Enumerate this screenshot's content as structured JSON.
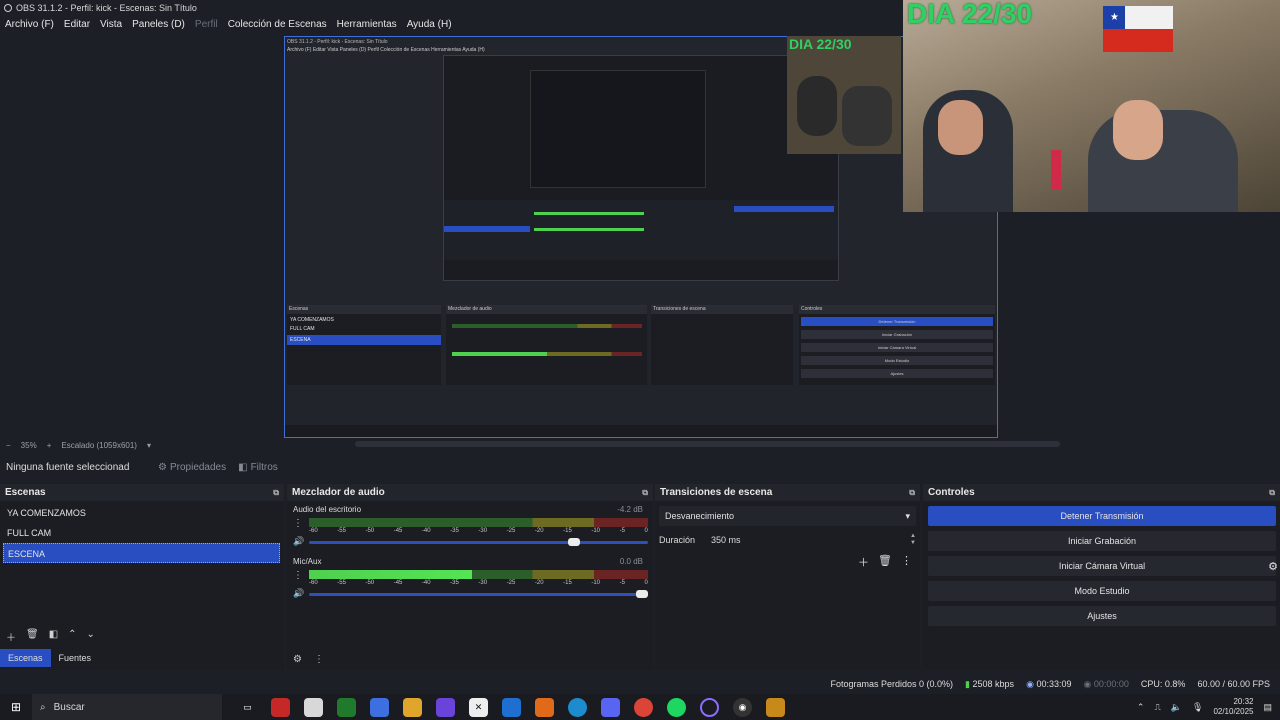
{
  "window": {
    "title": "OBS 31.1.2 - Perfil: kick - Escenas: Sin Título"
  },
  "menu": [
    "Archivo (F)",
    "Editar",
    "Vista",
    "Paneles (D)",
    "Perfil",
    "Colección de Escenas",
    "Herramientas",
    "Ayuda (H)"
  ],
  "overlay": {
    "day_counter": "DIA 22/30",
    "nested_counter": "DIA 22/30"
  },
  "nested": {
    "title": "OBS 31.1.2 - Perfil: kick - Escenas: Sin Título",
    "menu": "Archivo (F)   Editar   Vista   Paneles (D)   Perfil   Colección de Escenas   Herramientas   Ayuda (H)",
    "controls": [
      "Detener Transmisión",
      "Iniciar Grabación",
      "Iniciar Cámara Virtual",
      "Modo Estudio",
      "Ajustes"
    ],
    "scenes": [
      "YA COMENZAMOS",
      "FULL CAM",
      "ESCENA"
    ]
  },
  "zoom": {
    "minus": "−",
    "percent": "35%",
    "plus": "+",
    "scale": "Escalado (1059x601)"
  },
  "sources_bar": {
    "no_selection": "Ninguna fuente seleccionad",
    "properties": "Propiedades",
    "filters": "Filtros"
  },
  "scenes_dock": {
    "title": "Escenas",
    "items": [
      "YA COMENZAMOS",
      "FULL CAM",
      "ESCENA"
    ],
    "tabs": [
      "Escenas",
      "Fuentes"
    ]
  },
  "mixer": {
    "title": "Mezclador de audio",
    "ticks": [
      "-60",
      "-55",
      "-50",
      "-45",
      "-40",
      "-35",
      "-30",
      "-25",
      "-20",
      "-15",
      "-10",
      "-5",
      "0"
    ],
    "channels": [
      {
        "name": "Audio del escritorio",
        "db": "-4.2 dB",
        "level": 0,
        "volume": 0.8
      },
      {
        "name": "Mic/Aux",
        "db": "0.0 dB",
        "level": 0.48,
        "volume": 1.0
      }
    ]
  },
  "transitions": {
    "title": "Transiciones de escena",
    "selected": "Desvanecimiento",
    "duration_label": "Duración",
    "duration_value": "350 ms"
  },
  "controls": {
    "title": "Controles",
    "buttons": [
      "Detener Transmisión",
      "Iniciar Grabación",
      "Iniciar Cámara Virtual",
      "Modo Estudio",
      "Ajustes"
    ]
  },
  "status": {
    "dropped": "Fotogramas Perdidos 0 (0.0%)",
    "bitrate": "2508 kbps",
    "stream_time": "00:33:09",
    "rec_time": "00:00:00",
    "cpu": "CPU: 0.8%",
    "fps": "60.00 / 60.00 FPS"
  },
  "taskbar": {
    "search": "Buscar",
    "time": "20:32",
    "date": "02/10/2025"
  },
  "colors": {
    "accent": "#284ec2",
    "counter": "#2fd163"
  }
}
